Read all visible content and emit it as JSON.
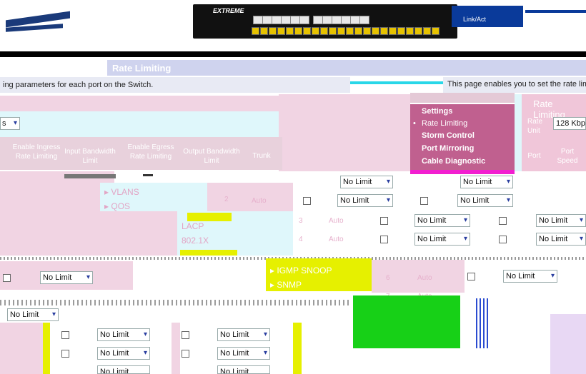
{
  "device": {
    "brand": "EXTREME",
    "legend": "Link/Act"
  },
  "page": {
    "title": "Rate Limiting",
    "desc_left": "ing parameters for each port on the Switch.",
    "desc_right": "This page enables you to set the rate limit"
  },
  "rate": {
    "title": "Rate Limiting",
    "unit_label": "Rate Unit",
    "unit_value": "128 Kbp",
    "mode_value": "s"
  },
  "columns": {
    "enable_ingress": "Enable Ingress Rate Limiting",
    "input_bw": "Input Bandwidth Limit",
    "enable_egress": "Enable Egress Rate Limiting",
    "output_bw": "Output Bandwidth Limit",
    "trunk": "Trunk",
    "port": "Port",
    "port_speed": "Port Speed"
  },
  "menu": {
    "items": [
      "Settings",
      "Rate Limiting",
      "Storm Control",
      "Port Mirroring",
      "Cable Diagnostic"
    ]
  },
  "nav": {
    "vlans": "VLANS",
    "qos": "QOS",
    "igmp": "IGMP SNOOP",
    "snmp": "SNMP",
    "lacp": "LACP",
    "8021x": "802.1X"
  },
  "limit_option": "No Limit",
  "speed_option": "Auto",
  "rows": [
    {
      "port": "2",
      "speed": "Auto"
    },
    {
      "port": "3",
      "speed": "Auto"
    },
    {
      "port": "4",
      "speed": "Auto"
    },
    {
      "port": "6",
      "speed": "Auto"
    },
    {
      "port": "7",
      "speed": "Auto"
    }
  ],
  "colors": {
    "menu_bg": "#c0608f",
    "nav_bar": "#cfd3ee",
    "pink_panel": "#f1d4e3",
    "cyan_panel": "#dff7fb",
    "yellow_glitch": "#e6f000",
    "green_glitch": "#17d017"
  }
}
